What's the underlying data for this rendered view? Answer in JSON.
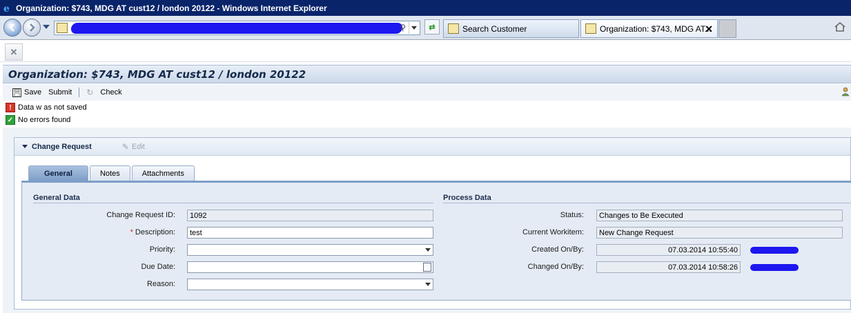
{
  "window": {
    "title": "Organization: $743, MDG AT cust12 / london 20122 - Windows Internet Explorer"
  },
  "browser": {
    "tabs": [
      {
        "label": "Search Customer"
      },
      {
        "label": "Organization: $743, MDG AT..."
      }
    ],
    "icons": {
      "back": "back-arrow-icon",
      "forward": "forward-arrow-icon",
      "home": "home-icon",
      "refresh": "refresh-icon",
      "close_tab": "close-icon"
    }
  },
  "page": {
    "title": "Organization: $743, MDG AT cust12 / london 20122"
  },
  "toolbar": {
    "save_label": "Save",
    "submit_label": "Submit",
    "check_label": "Check"
  },
  "messages": [
    {
      "type": "error",
      "text": "Data w as not saved"
    },
    {
      "type": "success",
      "text": "No errors found"
    }
  ],
  "change_request": {
    "panel_title": "Change Request",
    "edit_label": "Edit",
    "tabs": [
      {
        "label": "General",
        "active": true
      },
      {
        "label": "Notes",
        "active": false
      },
      {
        "label": "Attachments",
        "active": false
      }
    ],
    "general_data": {
      "title": "General Data",
      "fields": {
        "change_request_id": {
          "label": "Change Request ID:",
          "value": "1092"
        },
        "description": {
          "label": "Description:",
          "value": "test",
          "required": true
        },
        "priority": {
          "label": "Priority:",
          "value": ""
        },
        "due_date": {
          "label": "Due Date:",
          "value": ""
        },
        "reason": {
          "label": "Reason:",
          "value": ""
        }
      }
    },
    "process_data": {
      "title": "Process Data",
      "fields": {
        "status": {
          "label": "Status:",
          "value": "Changes to Be Executed"
        },
        "current_workitem": {
          "label": "Current Workitem:",
          "value": "New Change Request"
        },
        "created_on_by": {
          "label": "Created On/By:",
          "value": "07.03.2014 10:55:40"
        },
        "changed_on_by": {
          "label": "Changed On/By:",
          "value": "07.03.2014 10:58:26"
        }
      }
    }
  },
  "colors": {
    "titlebar": "#0a246a",
    "header_text": "#152a4a",
    "active_tab": "#7d9ec8",
    "redaction": "#1d17f0"
  }
}
